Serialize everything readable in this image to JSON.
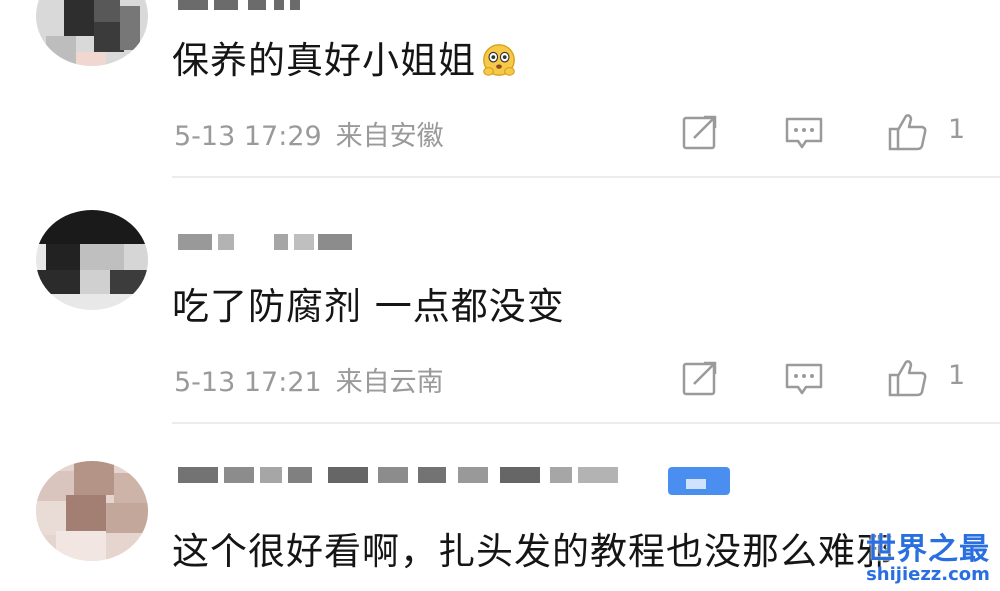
{
  "comments": [
    {
      "text": "保养的真好小姐姐",
      "emoji": "blushing-emoji",
      "time": "5-13 17:29",
      "location": "来自安徽",
      "likes": "1"
    },
    {
      "text": "吃了防腐剂 一点都没变",
      "time": "5-13 17:21",
      "location": "来自云南",
      "likes": "1"
    },
    {
      "text": "这个很好看啊，扎头发的教程也没那么难邪"
    }
  ],
  "icons": {
    "share": "share-icon",
    "reply": "comment-icon",
    "like": "thumbs-up-icon"
  },
  "watermark": {
    "title": "世界之最",
    "site": "shijiezz.com"
  },
  "colors": {
    "text": "#151515",
    "meta": "#9a9a9a",
    "divider": "#ececec",
    "watermark": "#2a6fe0"
  }
}
